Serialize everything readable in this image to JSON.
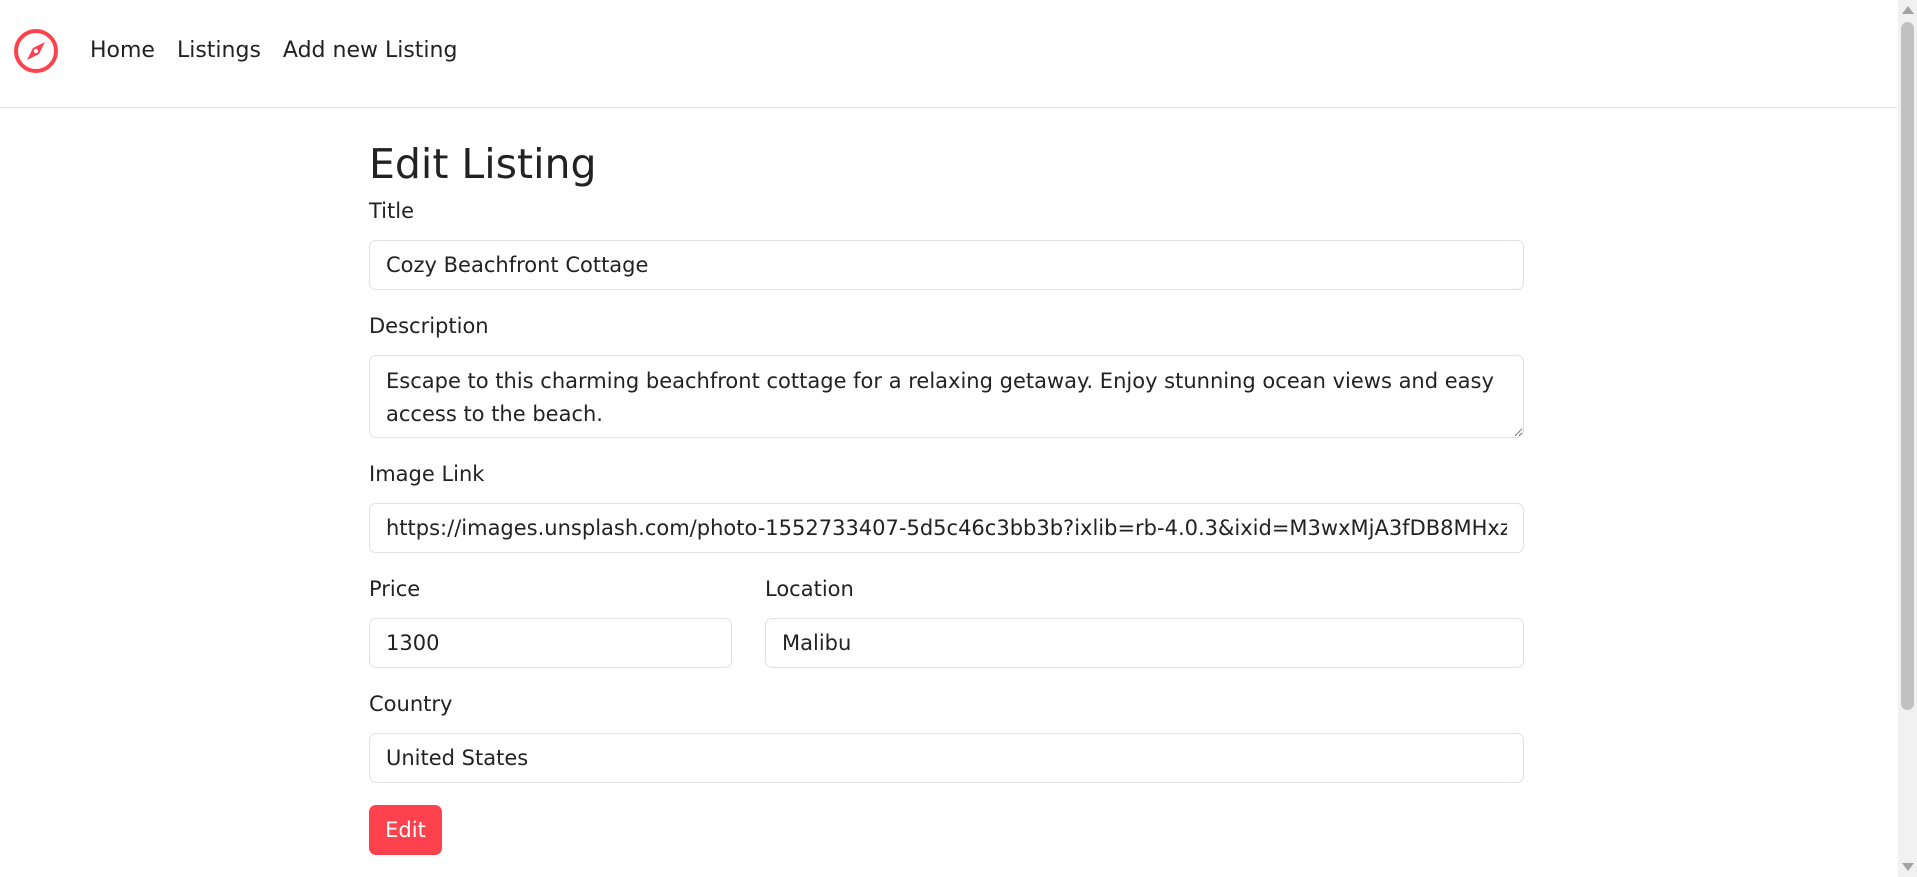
{
  "nav": {
    "logo_icon": "compass-icon",
    "brand_color": "#fe424d",
    "links": [
      "Home",
      "Listings",
      "Add new Listing"
    ]
  },
  "form": {
    "heading": "Edit Listing",
    "title": {
      "label": "Title",
      "value": "Cozy Beachfront Cottage"
    },
    "description": {
      "label": "Description",
      "value": "Escape to this charming beachfront cottage for a relaxing getaway. Enjoy stunning ocean views and easy access to the beach."
    },
    "image_link": {
      "label": "Image Link",
      "value": "https://images.unsplash.com/photo-1552733407-5d5c46c3bb3b?ixlib=rb-4.0.3&ixid=M3wxMjA3fDB8MHxz"
    },
    "price": {
      "label": "Price",
      "value": "1300"
    },
    "location": {
      "label": "Location",
      "value": "Malibu"
    },
    "country": {
      "label": "Country",
      "value": "United States"
    },
    "submit_label": "Edit"
  }
}
